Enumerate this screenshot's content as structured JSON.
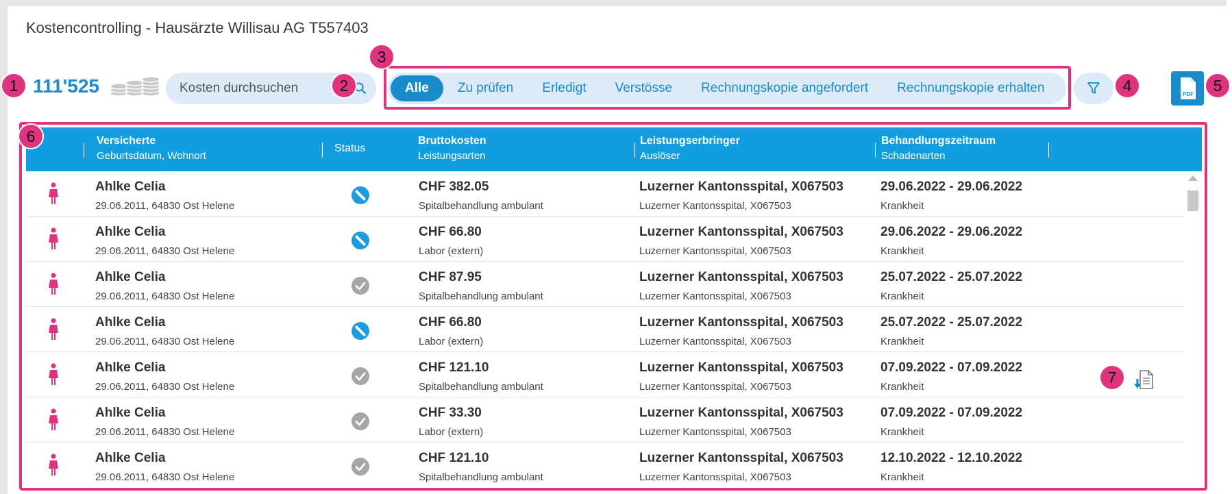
{
  "page": {
    "title": "Kostencontrolling - Hausärzte Willisau AG T557403"
  },
  "summary": {
    "count": "111'525",
    "coins_icon": "coins-icon"
  },
  "search": {
    "placeholder": "Kosten durchsuchen",
    "icon": "search-icon"
  },
  "tabs": [
    {
      "label": "Alle",
      "active": true
    },
    {
      "label": "Zu prüfen",
      "active": false
    },
    {
      "label": "Erledigt",
      "active": false
    },
    {
      "label": "Verstösse",
      "active": false
    },
    {
      "label": "Rechnungskopie angefordert",
      "active": false
    },
    {
      "label": "Rechnungskopie erhalten",
      "active": false
    }
  ],
  "toolbar": {
    "filter_icon": "filter-icon",
    "pdf_icon": "pdf-icon",
    "pdf_label": "PDF"
  },
  "annotations": [
    "1",
    "2",
    "3",
    "4",
    "5",
    "6",
    "7"
  ],
  "colors": {
    "accent": "#1a8ccc",
    "header": "#119ee0",
    "highlight": "#e0337f",
    "female": "#e0337f",
    "status_violation": "#1a9ce0",
    "status_done": "#a6a6a6"
  },
  "table": {
    "columns": {
      "versicherte": {
        "title": "Versicherte",
        "sub": "Geburtsdatum, Wohnort"
      },
      "status": {
        "title": "Status"
      },
      "brutto": {
        "title": "Bruttokosten",
        "sub": "Leistungsarten"
      },
      "leister": {
        "title": "Leistungserbringer",
        "sub": "Auslöser"
      },
      "zeitraum": {
        "title": "Behandlungszeitraum",
        "sub": "Schadenarten"
      }
    },
    "rows": [
      {
        "name": "Ahlke Celia",
        "birth": "29.06.2011, 64830 Ost Helene",
        "status": "violation",
        "cost": "CHF 382.05",
        "service": "Spitalbehandlung ambulant",
        "provider": "Luzerner Kantonsspital, X067503",
        "trigger": "Luzerner Kantonsspital, X067503",
        "period": "29.06.2022 - 29.06.2022",
        "damage": "Krankheit"
      },
      {
        "name": "Ahlke Celia",
        "birth": "29.06.2011, 64830 Ost Helene",
        "status": "violation",
        "cost": "CHF 66.80",
        "service": "Labor (extern)",
        "provider": "Luzerner Kantonsspital, X067503",
        "trigger": "Luzerner Kantonsspital, X067503",
        "period": "29.06.2022 - 29.06.2022",
        "damage": "Krankheit"
      },
      {
        "name": "Ahlke Celia",
        "birth": "29.06.2011, 64830 Ost Helene",
        "status": "done",
        "cost": "CHF 87.95",
        "service": "Spitalbehandlung ambulant",
        "provider": "Luzerner Kantonsspital, X067503",
        "trigger": "Luzerner Kantonsspital, X067503",
        "period": "25.07.2022 - 25.07.2022",
        "damage": "Krankheit"
      },
      {
        "name": "Ahlke Celia",
        "birth": "29.06.2011, 64830 Ost Helene",
        "status": "violation",
        "cost": "CHF 66.80",
        "service": "Labor (extern)",
        "provider": "Luzerner Kantonsspital, X067503",
        "trigger": "Luzerner Kantonsspital, X067503",
        "period": "25.07.2022 - 25.07.2022",
        "damage": "Krankheit"
      },
      {
        "name": "Ahlke Celia",
        "birth": "29.06.2011, 64830 Ost Helene",
        "status": "done",
        "cost": "CHF 121.10",
        "service": "Spitalbehandlung ambulant",
        "provider": "Luzerner Kantonsspital, X067503",
        "trigger": "Luzerner Kantonsspital, X067503",
        "period": "07.09.2022 - 07.09.2022",
        "damage": "Krankheit",
        "has_document": true
      },
      {
        "name": "Ahlke Celia",
        "birth": "29.06.2011, 64830 Ost Helene",
        "status": "done",
        "cost": "CHF 33.30",
        "service": "Labor (extern)",
        "provider": "Luzerner Kantonsspital, X067503",
        "trigger": "Luzerner Kantonsspital, X067503",
        "period": "07.09.2022 - 07.09.2022",
        "damage": "Krankheit"
      },
      {
        "name": "Ahlke Celia",
        "birth": "29.06.2011, 64830 Ost Helene",
        "status": "done",
        "cost": "CHF 121.10",
        "service": "Spitalbehandlung ambulant",
        "provider": "Luzerner Kantonsspital, X067503",
        "trigger": "Luzerner Kantonsspital, X067503",
        "period": "12.10.2022 - 12.10.2022",
        "damage": "Krankheit"
      }
    ]
  }
}
